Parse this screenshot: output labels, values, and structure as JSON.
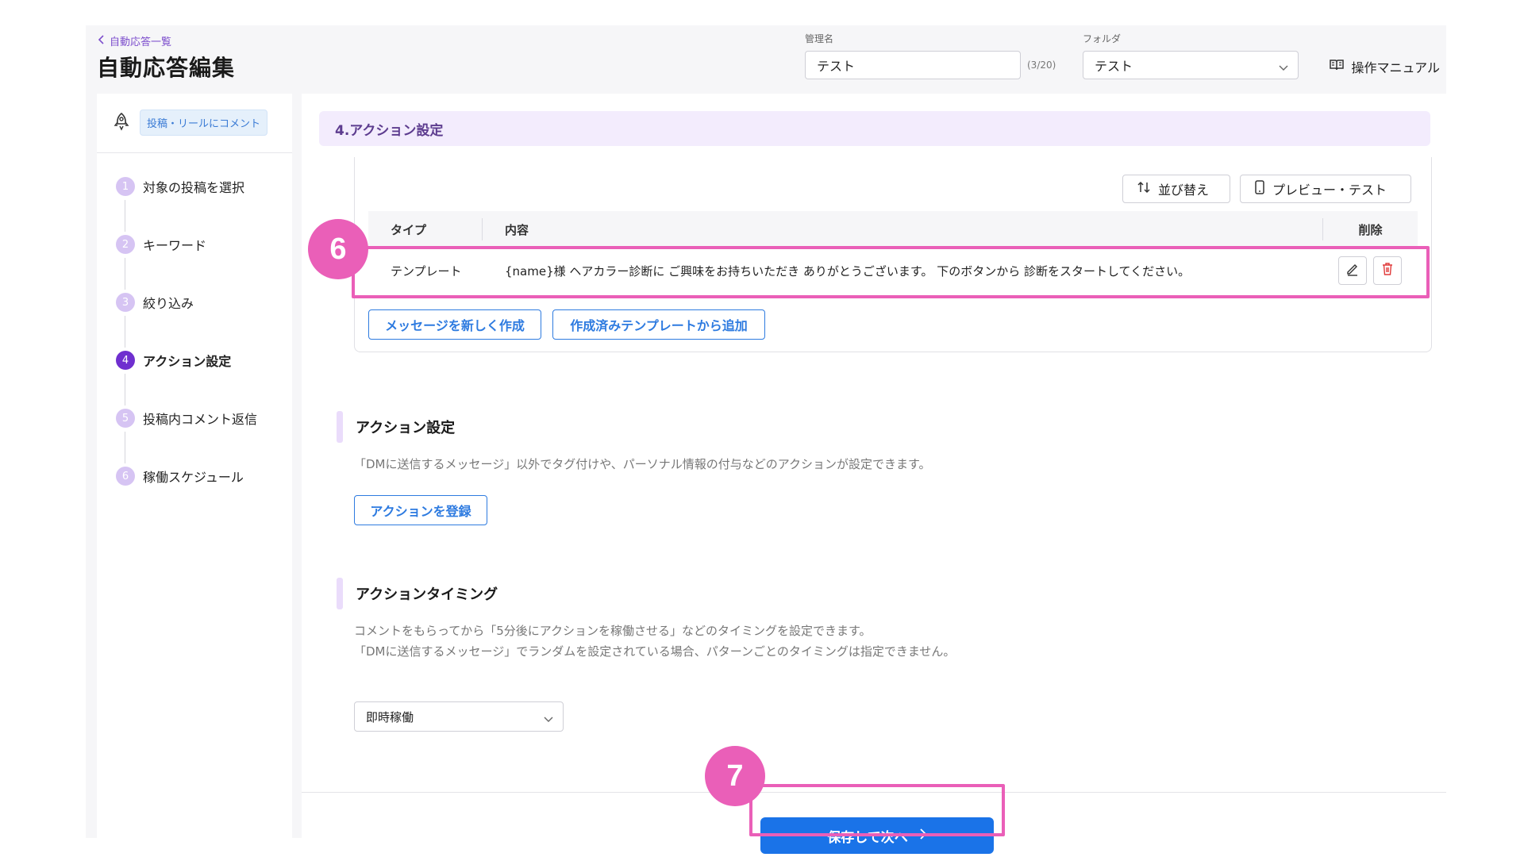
{
  "header": {
    "back_label": "自動応答一覧",
    "title": "自動応答編集",
    "name_label": "管理名",
    "name_value": "テスト",
    "name_counter": "(3/20)",
    "folder_label": "フォルダ",
    "folder_value": "テスト",
    "manual_label": "操作マニュアル"
  },
  "sidebar": {
    "trigger_badge": "投稿・リールにコメント",
    "steps": [
      {
        "num": "1",
        "label": "対象の投稿を選択"
      },
      {
        "num": "2",
        "label": "キーワード"
      },
      {
        "num": "3",
        "label": "絞り込み"
      },
      {
        "num": "4",
        "label": "アクション設定"
      },
      {
        "num": "5",
        "label": "投稿内コメント返信"
      },
      {
        "num": "6",
        "label": "稼働スケジュール"
      }
    ],
    "active_step": "4"
  },
  "main": {
    "section_title": "4.アクション設定",
    "sort_label": "並び替え",
    "preview_label": "プレビュー・テスト",
    "table": {
      "headers": {
        "type": "タイプ",
        "content": "内容",
        "delete": "削除"
      },
      "rows": [
        {
          "type": "テンプレート",
          "content": "{name}様 ヘアカラー診断に ご興味をお持ちいただき ありがとうございます。 下のボタンから 診断をスタートしてください。"
        }
      ]
    },
    "new_message_label": "メッセージを新しく作成",
    "add_template_label": "作成済みテンプレートから追加",
    "action_section": {
      "title": "アクション設定",
      "desc": "「DMに送信するメッセージ」以外でタグ付けや、パーソナル情報の付与などのアクションが設定できます。",
      "button": "アクションを登録"
    },
    "timing_section": {
      "title": "アクションタイミング",
      "desc1": "コメントをもらってから「5分後にアクションを稼働させる」などのタイミングを設定できます。",
      "desc2": "「DMに送信するメッセージ」でランダムを設定されている場合、パターンごとのタイミングは指定できません。",
      "select_value": "即時稼働"
    },
    "save_label": "保存して次へ"
  },
  "annotations": {
    "marker_6": "6",
    "marker_7": "7",
    "highlight_color": "#ea5fb8"
  },
  "colors": {
    "accent_purple": "#6f2fcf",
    "primary_blue": "#1a73e8",
    "delete_red": "#e03a3a"
  }
}
